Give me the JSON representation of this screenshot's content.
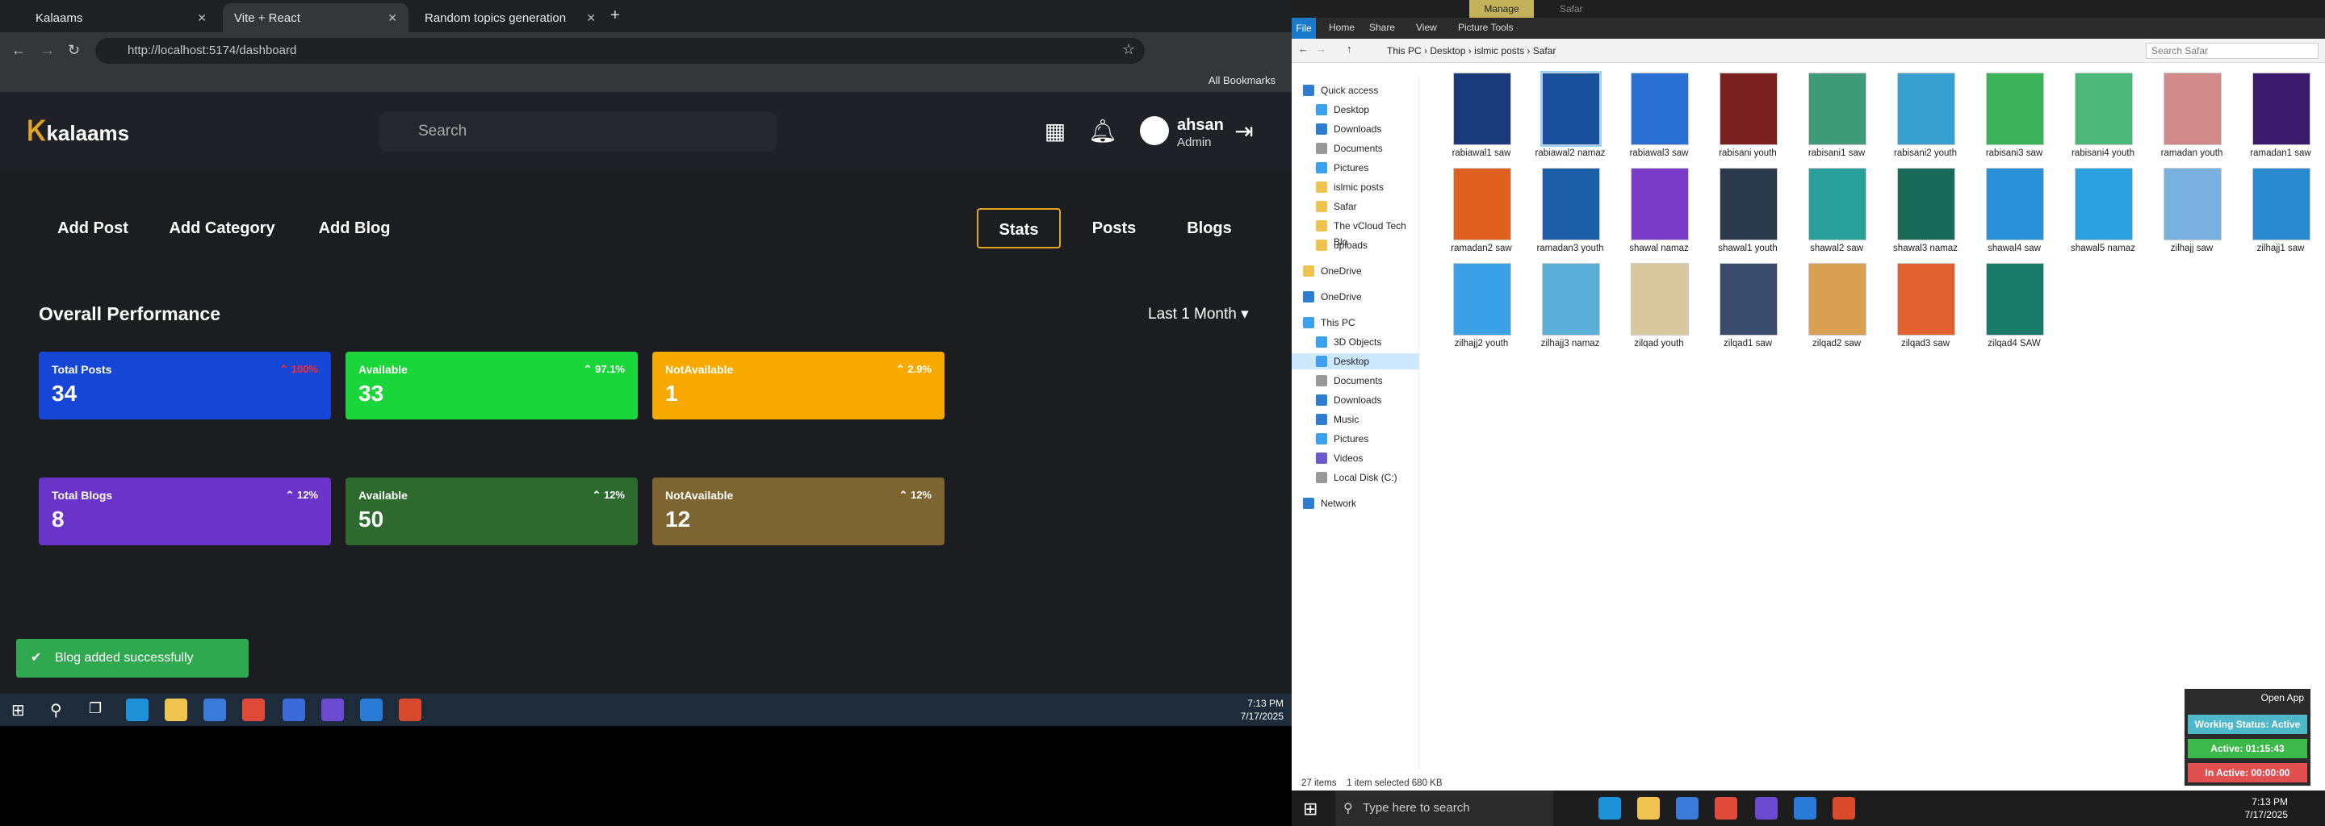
{
  "browser": {
    "tabs": [
      {
        "title": "Kalaams"
      },
      {
        "title": "Vite + React"
      },
      {
        "title": "Random topics generation"
      }
    ],
    "url": "http://localhost:5174/dashboard",
    "bookmarks_label": "All Bookmarks"
  },
  "app": {
    "logo": "kalaams",
    "search_placeholder": "Search",
    "user": {
      "name": "ahsan",
      "role": "Admin"
    },
    "left_nav": [
      "Add Post",
      "Add Category",
      "Add Blog"
    ],
    "right_nav": [
      "Stats",
      "Posts",
      "Blogs"
    ],
    "section_title": "Overall Performance",
    "range": "Last 1 Month",
    "post_cards": [
      {
        "label": "Total Posts",
        "value": "34",
        "pct": "100%",
        "color": "#1546d6",
        "pct_color": "#ff2a2a"
      },
      {
        "label": "Available",
        "value": "33",
        "pct": "97.1%",
        "color": "#1ad63a",
        "pct_color": "#ffffff"
      },
      {
        "label": "NotAvailable",
        "value": "1",
        "pct": "2.9%",
        "color": "#f7a900",
        "pct_color": "#ffffff"
      }
    ],
    "blog_cards": [
      {
        "label": "Total Blogs",
        "value": "8",
        "pct": "12%",
        "color": "#6a33c9",
        "pct_color": "#ffffff"
      },
      {
        "label": "Available",
        "value": "50",
        "pct": "12%",
        "color": "#2e6a2e",
        "pct_color": "#ffffff"
      },
      {
        "label": "NotAvailable",
        "value": "12",
        "pct": "12%",
        "color": "#7d6531",
        "pct_color": "#ffffff"
      }
    ],
    "toast": "Blog added successfully"
  },
  "taskbar_left": {
    "time": "7:13 PM",
    "date": "7/17/2025"
  },
  "explorer": {
    "ribbon_tabs": [
      "File",
      "Home",
      "Share",
      "View",
      "Picture Tools"
    ],
    "manage": "Manage",
    "window_title": "Safar",
    "path": [
      "This PC",
      "Desktop",
      "islmic posts",
      "Safar"
    ],
    "search_placeholder": "Search Safar",
    "nav": [
      {
        "label": "Quick access",
        "color": "#2d7dd2"
      },
      {
        "label": "Desktop",
        "color": "#3fa0f0"
      },
      {
        "label": "Downloads",
        "color": "#2d7dd2"
      },
      {
        "label": "Documents",
        "color": "#999"
      },
      {
        "label": "Pictures",
        "color": "#3fa0f0"
      },
      {
        "label": "islmic posts",
        "color": "#f0c24f"
      },
      {
        "label": "Safar",
        "color": "#f0c24f"
      },
      {
        "label": "The vCloud Tech Blo",
        "color": "#f0c24f"
      },
      {
        "label": "uploads",
        "color": "#f0c24f"
      },
      {
        "label": "OneDrive",
        "color": "#f0c24f"
      },
      {
        "label": "OneDrive",
        "color": "#2d7dd2"
      },
      {
        "label": "This PC",
        "color": "#3fa0f0"
      },
      {
        "label": "3D Objects",
        "color": "#3fa0f0"
      },
      {
        "label": "Desktop",
        "color": "#3fa0f0"
      },
      {
        "label": "Documents",
        "color": "#999"
      },
      {
        "label": "Downloads",
        "color": "#2d7dd2"
      },
      {
        "label": "Music",
        "color": "#2d7dd2"
      },
      {
        "label": "Pictures",
        "color": "#3fa0f0"
      },
      {
        "label": "Videos",
        "color": "#6a5acd"
      },
      {
        "label": "Local Disk (C:)",
        "color": "#999"
      },
      {
        "label": "Network",
        "color": "#2d7dd2"
      }
    ],
    "files": [
      {
        "name": "rabiawal1 saw",
        "color": "#1b3a7a"
      },
      {
        "name": "rabiawal2 namaz",
        "color": "#1a4f9c"
      },
      {
        "name": "rabiawal3 saw",
        "color": "#2a6fd2"
      },
      {
        "name": "rabisani youth",
        "color": "#7a2020"
      },
      {
        "name": "rabisani1 saw",
        "color": "#3f9a7a"
      },
      {
        "name": "rabisani2 youth",
        "color": "#38a0d0"
      },
      {
        "name": "rabisani3 saw",
        "color": "#3bb25a"
      },
      {
        "name": "rabisani4 youth",
        "color": "#4bb87a"
      },
      {
        "name": "ramadan youth",
        "color": "#d08a8a"
      },
      {
        "name": "ramadan1 saw",
        "color": "#3a1a6a"
      },
      {
        "name": "ramadan2 saw",
        "color": "#e06020"
      },
      {
        "name": "ramadan3 youth",
        "color": "#1c5fa8"
      },
      {
        "name": "shawal namaz",
        "color": "#7a3cc8"
      },
      {
        "name": "shawal1 youth",
        "color": "#2a3a4a"
      },
      {
        "name": "shawal2 saw",
        "color": "#2aa09a"
      },
      {
        "name": "shawal3 namaz",
        "color": "#1a6a5a"
      },
      {
        "name": "shawal4 saw",
        "color": "#2a90d8"
      },
      {
        "name": "shawal5 namaz",
        "color": "#2aa0e0"
      },
      {
        "name": "zilhajj saw",
        "color": "#7ab0e0"
      },
      {
        "name": "zilhajj1 saw",
        "color": "#2a8ad0"
      },
      {
        "name": "zilhajj2 youth",
        "color": "#3aa0e8"
      },
      {
        "name": "zilhajj3 namaz",
        "color": "#5ab0d8"
      },
      {
        "name": "zilqad youth",
        "color": "#d8c8a0"
      },
      {
        "name": "zilqad1 saw",
        "color": "#3a4a6a"
      },
      {
        "name": "zilqad2 saw",
        "color": "#d8a050"
      },
      {
        "name": "zilqad3 saw",
        "color": "#e06030"
      },
      {
        "name": "zilqad4 SAW",
        "color": "#1a7a6a"
      }
    ],
    "status_items": "27 items",
    "status_selected": "1 item selected  680 KB"
  },
  "widget": {
    "open_app": "Open App",
    "working": "Working Status: Active",
    "active": "Active: 01:15:43",
    "inactive": "In Active: 00:00:00"
  },
  "taskbar_right": {
    "search": "Type here to search",
    "time": "7:13 PM",
    "date": "7/17/2025"
  }
}
